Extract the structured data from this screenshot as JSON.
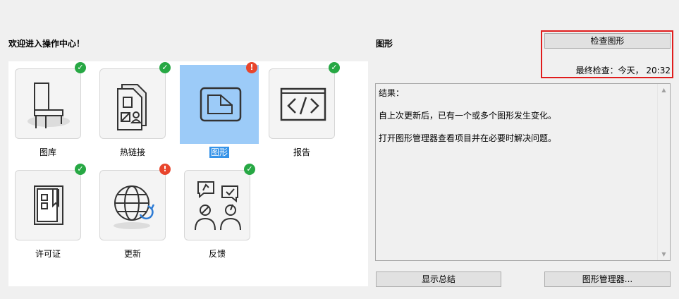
{
  "welcome": "欢迎进入操作中心！",
  "section_title": "图形",
  "check_button": "检查图形",
  "last_check": "最终检查：今天， 20:32",
  "tiles": [
    {
      "label": "图库",
      "status": "ok",
      "icon": "chair-icon"
    },
    {
      "label": "热链接",
      "status": "ok",
      "icon": "hotlink-document-icon"
    },
    {
      "label": "图形",
      "status": "warn",
      "icon": "drawing-sheet-icon",
      "selected": true
    },
    {
      "label": "报告",
      "status": "ok",
      "icon": "code-report-icon"
    },
    {
      "label": "许可证",
      "status": "ok",
      "icon": "license-book-icon"
    },
    {
      "label": "更新",
      "status": "warn",
      "icon": "globe-update-icon"
    },
    {
      "label": "反馈",
      "status": "ok",
      "icon": "feedback-people-icon"
    }
  ],
  "badges": {
    "ok": "✓",
    "warn": "!"
  },
  "result": {
    "heading": "结果：",
    "line1": "自上次更新后，已有一个或多个图形发生变化。",
    "line2": "打开图形管理器查看项目并在必要时解决问题。"
  },
  "scroll": {
    "up": "▲",
    "down": "▼"
  },
  "buttons": {
    "summary": "显示总结",
    "manager": "图形管理器..."
  },
  "colors": {
    "ok": "#27a844",
    "warn": "#e8452c",
    "selected_bg": "#9ccbf8",
    "selected_label": "#3593e8",
    "highlight": "#e01c1c"
  }
}
